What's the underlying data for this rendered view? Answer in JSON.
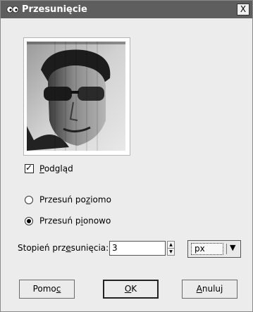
{
  "window": {
    "title": "Przesunięcie",
    "close_label": "X"
  },
  "preview": {
    "checkbox_checked": true,
    "label_pre": "",
    "label_u": "P",
    "label_post": "odgląd"
  },
  "direction": {
    "options": [
      {
        "label_pre": "Przesuń po",
        "label_u": "z",
        "label_post": "iomo",
        "selected": false
      },
      {
        "label_pre": "Przesuń p",
        "label_u": "i",
        "label_post": "onowo",
        "selected": true
      }
    ]
  },
  "amount": {
    "label_pre": "Stopień prz",
    "label_u": "e",
    "label_post": "sunięcia:",
    "value": "3",
    "unit": "px"
  },
  "buttons": {
    "help": {
      "label_pre": "Pomo",
      "label_u": "c",
      "label_post": ""
    },
    "ok": {
      "label_pre": "",
      "label_u": "O",
      "label_post": "K"
    },
    "cancel": {
      "label_pre": "",
      "label_u": "A",
      "label_post": "nuluj"
    }
  }
}
